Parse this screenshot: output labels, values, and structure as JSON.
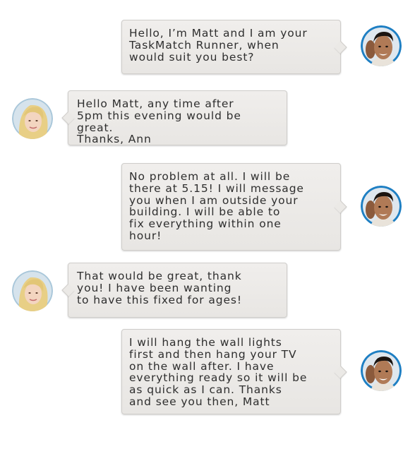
{
  "conversation": {
    "messages": [
      {
        "sender": "Matt",
        "side": "right",
        "text": "Hello, I’m Matt and I am your\nTaskMatch Runner, when\nwould suit you best?"
      },
      {
        "sender": "Ann",
        "side": "left",
        "text": "Hello Matt, any time after\n5pm this evening would be\ngreat.\nThanks, Ann"
      },
      {
        "sender": "Matt",
        "side": "right",
        "text": "No problem at all. I will be\nthere at 5.15! I will message\nyou when I am outside your\nbuilding. I will be able to\nfix everything within one\nhour!"
      },
      {
        "sender": "Ann",
        "side": "left",
        "text": "That would be great, thank\nyou! I have been wanting\nto have this fixed for ages!"
      },
      {
        "sender": "Matt",
        "side": "right",
        "text": "I will hang the wall lights\nfirst and then hang your TV\non the wall after. I have\neverything ready so it will be\nas quick as I can. Thanks\nand see you then, Matt"
      }
    ]
  },
  "icons": {
    "runner_avatar": "male-runner-avatar-icon",
    "customer_avatar": "female-customer-avatar-icon"
  },
  "colors": {
    "bubble_background": "#ebe9e6",
    "bubble_border": "#cfcdca",
    "runner_avatar_ring": "#1e7fc3",
    "text": "#2e2e2e"
  }
}
